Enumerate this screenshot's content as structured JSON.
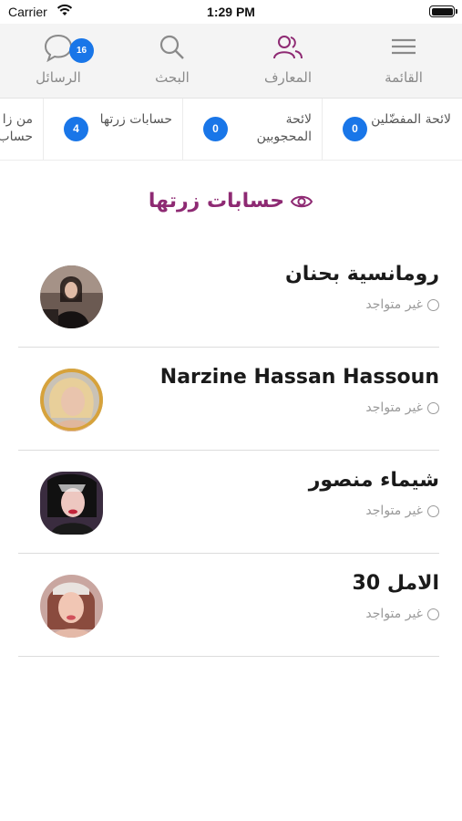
{
  "status_bar": {
    "carrier": "Carrier",
    "time": "1:29 PM"
  },
  "tabs": [
    {
      "label": "القائمة",
      "icon": "menu-icon"
    },
    {
      "label": "المعارف",
      "icon": "people-icon"
    },
    {
      "label": "البحث",
      "icon": "search-icon"
    },
    {
      "label": "الرسائل",
      "icon": "chat-icon",
      "badge": "16"
    }
  ],
  "subtabs": [
    {
      "label": "لائحة المفضّلين",
      "count": "0"
    },
    {
      "label": "لائحة المحجوبين",
      "count": "0"
    },
    {
      "label": "حسابات زرتها",
      "count": "4"
    },
    {
      "label": "من زا حساب"
    }
  ],
  "section": {
    "title": "حسابات زرتها",
    "icon": "eye-icon"
  },
  "visited_accounts": [
    {
      "name": "رومانسية بحنان",
      "status": "غير متواجد"
    },
    {
      "name": "Narzine Hassan Hassoun",
      "status": "غير متواجد"
    },
    {
      "name": "شيماء منصور",
      "status": "غير متواجد"
    },
    {
      "name": "الامل 30",
      "status": "غير متواجد"
    }
  ],
  "colors": {
    "accent": "#8e2a73",
    "badge": "#1976e8",
    "tabbar_bg": "#f4f4f4"
  }
}
